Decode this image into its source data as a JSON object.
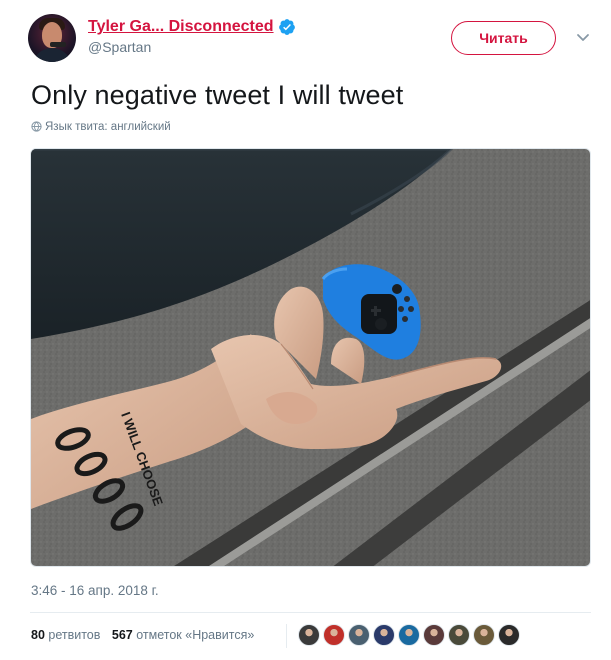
{
  "author": {
    "display_name": "Tyler Ga... Disconnected",
    "handle": "@Spartan",
    "verified": true,
    "avatar_icon": "profile-avatar"
  },
  "actions": {
    "follow_label": "Читать",
    "more_icon": "chevron-down-icon"
  },
  "tweet": {
    "text": "Only negative tweet I will tweet",
    "language_label": "Язык твита: английский",
    "timestamp": "3:46 - 16 апр. 2018 г."
  },
  "media": {
    "description_icon": "photo",
    "tattoo_text": "I WILL CHOOSE"
  },
  "stats": {
    "retweets_count": "80",
    "retweets_label": "ретвитов",
    "likes_count": "567",
    "likes_label": "отметок «Нравится»"
  },
  "likers": [
    {
      "name": "liker-avatar-1",
      "color": "#3a3a3a"
    },
    {
      "name": "liker-avatar-2",
      "color": "#c0302a"
    },
    {
      "name": "liker-avatar-3",
      "color": "#4a6070"
    },
    {
      "name": "liker-avatar-4",
      "color": "#2a3a6a"
    },
    {
      "name": "liker-avatar-5",
      "color": "#1a6aa0"
    },
    {
      "name": "liker-avatar-6",
      "color": "#5a3a3a"
    },
    {
      "name": "liker-avatar-7",
      "color": "#4a4a3a"
    },
    {
      "name": "liker-avatar-8",
      "color": "#6a5a3a"
    },
    {
      "name": "liker-avatar-9",
      "color": "#2a2a2a"
    }
  ],
  "colors": {
    "accent": "#d4143f",
    "muted": "#657786",
    "verified": "#1da1f2",
    "controller": "#1f7fe0"
  }
}
